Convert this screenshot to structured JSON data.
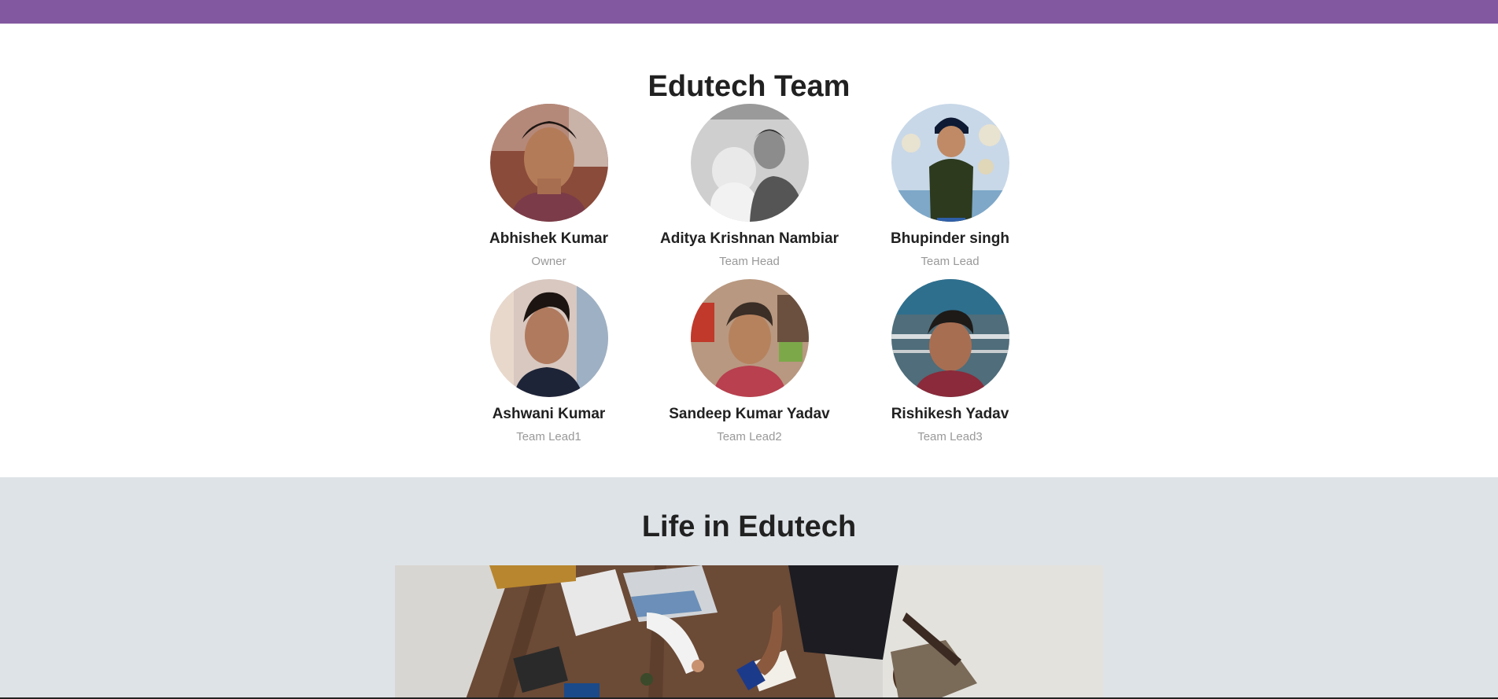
{
  "colors": {
    "top_bar": "#8259a0",
    "team_bg": "#ffffff",
    "life_bg": "#dee3e7",
    "name": "#212121",
    "role": "#999999"
  },
  "team": {
    "title": "Edutech Team",
    "members": [
      {
        "name": "Abhishek Kumar",
        "role": "Owner",
        "photo_icon": "person-photo"
      },
      {
        "name": "Aditya Krishnan Nambiar",
        "role": "Team Head",
        "photo_icon": "person-with-dog-photo"
      },
      {
        "name": "Bhupinder singh",
        "role": "Team Lead",
        "photo_icon": "person-photo"
      },
      {
        "name": "Ashwani Kumar",
        "role": "Team Lead1",
        "photo_icon": "person-photo"
      },
      {
        "name": "Sandeep Kumar Yadav",
        "role": "Team Lead2",
        "photo_icon": "person-photo"
      },
      {
        "name": "Rishikesh Yadav",
        "role": "Team Lead3",
        "photo_icon": "person-photo"
      }
    ]
  },
  "life": {
    "title": "Life in Edutech",
    "photo_icon": "team-meeting-photo"
  }
}
